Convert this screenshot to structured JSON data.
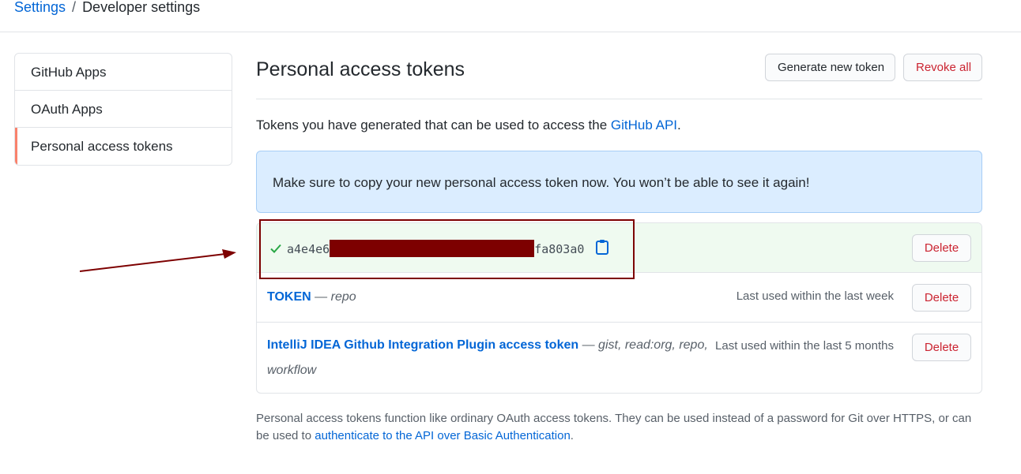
{
  "breadcrumb": {
    "settings": "Settings",
    "separator": "/",
    "current": "Developer settings"
  },
  "sidebar": {
    "items": [
      {
        "label": "GitHub Apps"
      },
      {
        "label": "OAuth Apps"
      },
      {
        "label": "Personal access tokens",
        "selected": true
      }
    ]
  },
  "main": {
    "title": "Personal access tokens",
    "generate_label": "Generate new token",
    "revoke_label": "Revoke all",
    "description_prefix": "Tokens you have generated that can be used to access the ",
    "description_link": "GitHub API",
    "description_suffix": ".",
    "flash": "Make sure to copy your new personal access token now. You won’t be able to see it again!"
  },
  "new_token": {
    "prefix": "a4e4e6",
    "suffix": "fa803a0",
    "delete_label": "Delete"
  },
  "tokens": [
    {
      "name": "TOKEN",
      "dash": "—",
      "scopes": "repo",
      "last_used": "Last used within the last week",
      "delete_label": "Delete"
    },
    {
      "name": "IntelliJ IDEA Github Integration Plugin access token",
      "dash": "—",
      "scopes": "gist, read:org, repo, workflow",
      "last_used": "Last used within the last 5 months",
      "delete_label": "Delete"
    }
  ],
  "footer_note": {
    "text": "Personal access tokens function like ordinary OAuth access tokens. They can be used instead of a password for Git over HTTPS, or can be used to ",
    "link": "authenticate to the API over Basic Authentication",
    "suffix": "."
  },
  "colors": {
    "link": "#0366d6",
    "danger": "#cb2431",
    "flash_bg": "#dbedff",
    "new_token_bg": "#effaf0",
    "annotation": "#7d0000",
    "selected_marker": "#f9826c"
  },
  "icons": [
    "check-icon",
    "clipboard-icon"
  ]
}
